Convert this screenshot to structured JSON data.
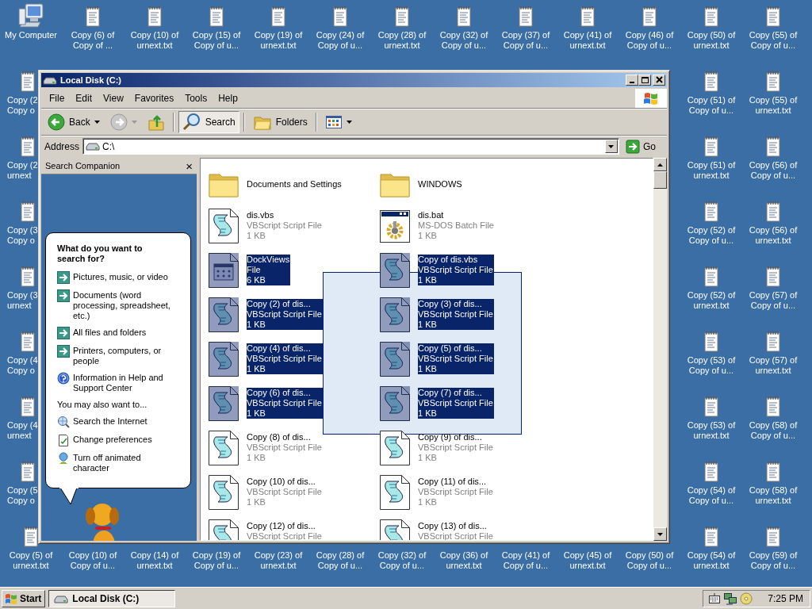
{
  "desktop": {
    "top_row": [
      {
        "kind": "computer",
        "lines": [
          "My Computer"
        ]
      },
      {
        "kind": "text_file",
        "lines": [
          "Copy (6) of",
          "Copy of ..."
        ]
      },
      {
        "kind": "text_file",
        "lines": [
          "Copy (10) of",
          "urnext.txt"
        ]
      },
      {
        "kind": "text_file",
        "lines": [
          "Copy (15) of",
          "Copy of u..."
        ]
      },
      {
        "kind": "text_file",
        "lines": [
          "Copy (19) of",
          "urnext.txt"
        ]
      },
      {
        "kind": "text_file",
        "lines": [
          "Copy (24) of",
          "Copy of u..."
        ]
      },
      {
        "kind": "text_file",
        "lines": [
          "Copy (28) of",
          "urnext.txt"
        ]
      },
      {
        "kind": "text_file",
        "lines": [
          "Copy (32) of",
          "Copy of u..."
        ]
      },
      {
        "kind": "text_file",
        "lines": [
          "Copy (37) of",
          "Copy of u..."
        ]
      },
      {
        "kind": "text_file",
        "lines": [
          "Copy (41) of",
          "urnext.txt"
        ]
      },
      {
        "kind": "text_file",
        "lines": [
          "Copy (46) of",
          "Copy of u..."
        ]
      },
      {
        "kind": "text_file",
        "lines": [
          "Copy (50) of",
          "urnext.txt"
        ]
      },
      {
        "kind": "text_file",
        "lines": [
          "Copy (55) of",
          "Copy of u..."
        ]
      }
    ],
    "left_column": [
      {
        "kind": "text_file",
        "lines": [
          "Copy (2",
          "Copy o"
        ]
      },
      {
        "kind": "text_file",
        "lines": [
          "Copy (2",
          "urnext"
        ]
      },
      {
        "kind": "text_file",
        "lines": [
          "Copy (3",
          "Copy o"
        ]
      },
      {
        "kind": "text_file",
        "lines": [
          "Copy (3",
          "urnext"
        ]
      },
      {
        "kind": "text_file",
        "lines": [
          "Copy (4",
          "Copy o"
        ]
      },
      {
        "kind": "text_file",
        "lines": [
          "Copy (4",
          "urnext"
        ]
      },
      {
        "kind": "text_file",
        "lines": [
          "Copy (5",
          "Copy o"
        ]
      }
    ],
    "right_columns": [
      [
        {
          "kind": "text_file",
          "lines": [
            "Copy (51) of",
            "Copy of u..."
          ]
        },
        {
          "kind": "text_file",
          "lines": [
            "Copy (55) of",
            "urnext.txt"
          ]
        }
      ],
      [
        {
          "kind": "text_file",
          "lines": [
            "Copy (51) of",
            "urnext.txt"
          ]
        },
        {
          "kind": "text_file",
          "lines": [
            "Copy (56) of",
            "Copy of u..."
          ]
        }
      ],
      [
        {
          "kind": "text_file",
          "lines": [
            "Copy (52) of",
            "Copy of u..."
          ]
        },
        {
          "kind": "text_file",
          "lines": [
            "Copy (56) of",
            "urnext.txt"
          ]
        }
      ],
      [
        {
          "kind": "text_file",
          "lines": [
            "Copy (52) of",
            "urnext.txt"
          ]
        },
        {
          "kind": "text_file",
          "lines": [
            "Copy (57) of",
            "Copy of u..."
          ]
        }
      ],
      [
        {
          "kind": "text_file",
          "lines": [
            "Copy (53) of",
            "Copy of u..."
          ]
        },
        {
          "kind": "text_file",
          "lines": [
            "Copy (57) of",
            "urnext.txt"
          ]
        }
      ],
      [
        {
          "kind": "text_file",
          "lines": [
            "Copy (53) of",
            "urnext.txt"
          ]
        },
        {
          "kind": "text_file",
          "lines": [
            "Copy (58) of",
            "Copy of u..."
          ]
        }
      ],
      [
        {
          "kind": "text_file",
          "lines": [
            "Copy (54) of",
            "Copy of u..."
          ]
        },
        {
          "kind": "text_file",
          "lines": [
            "Copy (58) of",
            "urnext.txt"
          ]
        }
      ]
    ],
    "bottom_row": [
      {
        "kind": "text_file",
        "lines": [
          "Copy (5) of",
          "urnext.txt"
        ]
      },
      {
        "kind": "text_file",
        "lines": [
          "Copy (10) of",
          "Copy of u..."
        ]
      },
      {
        "kind": "text_file",
        "lines": [
          "Copy (14) of",
          "urnext.txt"
        ]
      },
      {
        "kind": "text_file",
        "lines": [
          "Copy (19) of",
          "Copy of u..."
        ]
      },
      {
        "kind": "text_file",
        "lines": [
          "Copy (23) of",
          "urnext.txt"
        ]
      },
      {
        "kind": "text_file",
        "lines": [
          "Copy (28) of",
          "Copy of u..."
        ]
      },
      {
        "kind": "text_file",
        "lines": [
          "Copy (32) of",
          "Copy of u..."
        ]
      },
      {
        "kind": "text_file",
        "lines": [
          "Copy (36) of",
          "urnext.txt"
        ]
      },
      {
        "kind": "text_file",
        "lines": [
          "Copy (41) of",
          "Copy of u..."
        ]
      },
      {
        "kind": "text_file",
        "lines": [
          "Copy (45) of",
          "urnext.txt"
        ]
      },
      {
        "kind": "text_file",
        "lines": [
          "Copy (50) of",
          "Copy of u..."
        ]
      },
      {
        "kind": "text_file",
        "lines": [
          "Copy (54) of",
          "urnext.txt"
        ]
      },
      {
        "kind": "text_file",
        "lines": [
          "Copy (59) of",
          "Copy of u..."
        ]
      }
    ]
  },
  "window": {
    "title": "Local Disk (C:)",
    "menu": [
      "File",
      "Edit",
      "View",
      "Favorites",
      "Tools",
      "Help"
    ],
    "toolbar": [
      {
        "kind": "back",
        "label": "Back",
        "disabled": false
      },
      {
        "kind": "forward",
        "disabled": true
      },
      {
        "kind": "up"
      },
      {
        "kind": "search",
        "label": "Search",
        "pressed": true
      },
      {
        "kind": "folders",
        "label": "Folders",
        "pressed": false
      },
      {
        "kind": "views"
      }
    ],
    "address": {
      "label": "Address",
      "value": "C:\\",
      "go": "Go"
    },
    "search_pane": {
      "title": "Search Companion",
      "close": "×",
      "question": "What do you want to search for?",
      "options": [
        {
          "kind": "arrow",
          "label": "Pictures, music, or video"
        },
        {
          "kind": "arrow",
          "label": "Documents (word processing, spreadsheet, etc.)"
        },
        {
          "kind": "arrow",
          "label": "All files and folders"
        },
        {
          "kind": "arrow",
          "label": "Printers, computers, or people"
        },
        {
          "kind": "help",
          "label": "Information in Help and Support Center"
        }
      ],
      "more_heading": "You may also want to...",
      "more_options": [
        {
          "kind": "internet",
          "label": "Search the Internet"
        },
        {
          "kind": "preferences",
          "label": "Change preferences"
        },
        {
          "kind": "character",
          "label": "Turn off animated character"
        }
      ]
    },
    "files": {
      "marquee": true,
      "items": [
        {
          "kind": "folder",
          "name": "Documents and Settings",
          "selected": false
        },
        {
          "kind": "folder",
          "name": "WINDOWS",
          "selected": false
        },
        {
          "kind": "script",
          "name": "dis.vbs",
          "type": "VBScript Script File",
          "size": "1 KB",
          "selected": false
        },
        {
          "kind": "batch",
          "name": "dis.bat",
          "type": "MS-DOS Batch File",
          "size": "1 KB",
          "selected": false
        },
        {
          "kind": "dockviews",
          "name": "DockViews",
          "type": "File",
          "size": "6 KB",
          "selected": true
        },
        {
          "kind": "script",
          "name": "Copy of dis.vbs",
          "type": "VBScript Script File",
          "size": "1 KB",
          "selected": true
        },
        {
          "kind": "script",
          "name": "Copy (2) of dis...",
          "type": "VBScript Script File",
          "size": "1 KB",
          "selected": true
        },
        {
          "kind": "script",
          "name": "Copy (3) of dis...",
          "type": "VBScript Script File",
          "size": "1 KB",
          "selected": true
        },
        {
          "kind": "script",
          "name": "Copy (4) of dis...",
          "type": "VBScript Script File",
          "size": "1 KB",
          "selected": true
        },
        {
          "kind": "script",
          "name": "Copy (5) of dis...",
          "type": "VBScript Script File",
          "size": "1 KB",
          "selected": true
        },
        {
          "kind": "script",
          "name": "Copy (6) of dis...",
          "type": "VBScript Script File",
          "size": "1 KB",
          "selected": true
        },
        {
          "kind": "script",
          "name": "Copy (7) of dis...",
          "type": "VBScript Script File",
          "size": "1 KB",
          "selected": true
        },
        {
          "kind": "script",
          "name": "Copy (8) of dis...",
          "type": "VBScript Script File",
          "size": "1 KB",
          "selected": false
        },
        {
          "kind": "script",
          "name": "Copy (9) of dis...",
          "type": "VBScript Script File",
          "size": "1 KB",
          "selected": false
        },
        {
          "kind": "script",
          "name": "Copy (10) of dis...",
          "type": "VBScript Script File",
          "size": "1 KB",
          "selected": false
        },
        {
          "kind": "script",
          "name": "Copy (11) of dis...",
          "type": "VBScript Script File",
          "size": "1 KB",
          "selected": false
        },
        {
          "kind": "script",
          "name": "Copy (12) of dis...",
          "type": "VBScript Script File",
          "selected": false
        },
        {
          "kind": "script",
          "name": "Copy (13) of dis...",
          "type": "VBScript Script File",
          "selected": false
        }
      ]
    }
  },
  "taskbar": {
    "start": "Start",
    "tasks": [
      {
        "label": "Local Disk (C:)",
        "selected": true
      }
    ],
    "clock": "7:25 PM"
  }
}
